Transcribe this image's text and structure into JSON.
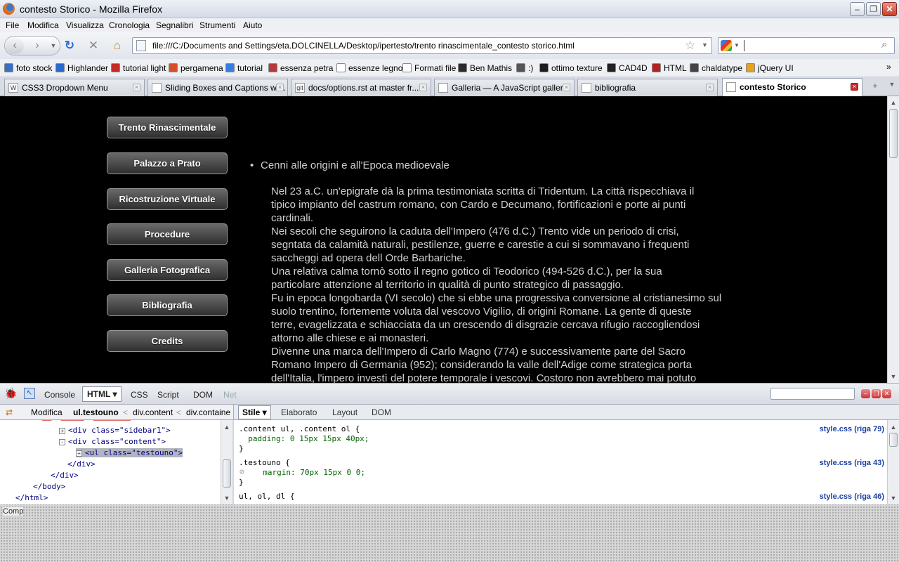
{
  "window": {
    "title": "contesto Storico - Mozilla Firefox"
  },
  "menu": [
    "File",
    "Modifica",
    "Visualizza",
    "Cronologia",
    "Segnalibri",
    "Strumenti",
    "Aiuto"
  ],
  "nav": {
    "url": "file:///C:/Documents and Settings/eta.DOLCINELLA/Desktop/ipertesto/trento rinascimentale_contesto storico.html",
    "search_value": ""
  },
  "bookmarks": [
    {
      "label": "foto stock",
      "icon": "folder-icon",
      "color": "#3b6fc2"
    },
    {
      "label": "Highlander",
      "icon": "highlander-icon",
      "color": "#2a6acb"
    },
    {
      "label": "tutorial light",
      "icon": "tutorial-icon",
      "color": "#c42a2a"
    },
    {
      "label": "pergamena",
      "icon": "vlc-icon",
      "color": "#d5502a"
    },
    {
      "label": "tutorial",
      "icon": "google-icon",
      "color": "#3a7de0"
    },
    {
      "label": "essenza petra",
      "icon": "essenza-icon",
      "color": "#b33a3a"
    },
    {
      "label": "essenze legno",
      "icon": "page-icon",
      "color": "#ffffff"
    },
    {
      "label": "Formati file",
      "icon": "page-icon",
      "color": "#ffffff"
    },
    {
      "label": "Ben Mathis",
      "icon": "benmathis-icon",
      "color": "#2b2b2b"
    },
    {
      "label": ":)",
      "icon": "p-icon",
      "color": "#555555"
    },
    {
      "label": "ottimo texture",
      "icon": "fst-icon",
      "color": "#1d1d1d"
    },
    {
      "label": "CAD4D",
      "icon": "cad4d-icon",
      "color": "#222222"
    },
    {
      "label": "HTML",
      "icon": "html-icon",
      "color": "#b22222"
    },
    {
      "label": "chaldatype",
      "icon": "chaldatype-icon",
      "color": "#444444"
    },
    {
      "label": "jQuery UI",
      "icon": "jquery-icon",
      "color": "#e8a31c"
    }
  ],
  "tabs": [
    {
      "label": "CSS3 Dropdown Menu",
      "icon": "W"
    },
    {
      "label": "Sliding Boxes and Captions wi...",
      "icon": ""
    },
    {
      "label": "docs/options.rst at master fr...",
      "icon": "git"
    },
    {
      "label": "Galleria — A JavaScript galler...",
      "icon": ""
    },
    {
      "label": "bibliografia",
      "icon": ""
    },
    {
      "label": "contesto Storico",
      "icon": ""
    }
  ],
  "sidebar_buttons": [
    "Trento Rinascimentale",
    "Palazzo a Prato",
    "Ricostruzione Virtuale",
    "Procedure",
    "Galleria Fotografica",
    "Bibliografia",
    "Credits"
  ],
  "content": {
    "heading": "Cenni alle origini e all'Epoca medioevale",
    "lines": [
      "Nel 23 a.C. un'epigrafe dà la prima testimoniata scritta di Tridentum. La città rispecchiava il",
      "tipico impianto del castrum romano, con Cardo e Decumano, fortificazioni e porte ai punti",
      "cardinali.",
      "Nei secoli che seguirono la caduta dell'Impero (476 d.C.) Trento vide un periodo di crisi,",
      "segntata da calamità naturali, pestilenze, guerre e carestie a cui si sommavano i frequenti",
      "saccheggi ad opera dell Orde Barbariche.",
      "Una relativa calma tornò sotto il regno gotico di Teodorico (494-526 d.C.), per la sua",
      "particolare attenzione al territorio in qualità di punto strategico di passaggio.",
      "Fu in epoca longobarda (VI secolo) che si ebbe una progressiva conversione al cristianesimo sul",
      "suolo trentino, fortemente voluta dal vescovo Vigilio, di origini Romane. La gente di queste",
      "terre, evagelizzata e schiacciata da un crescendo di disgrazie cercava rifugio raccogliendosi",
      "attorno alle chiese e ai monasteri.",
      "Divenne una marca dell'Impero di Carlo Magno (774) e successivamente parte del Sacro",
      "Romano Impero di Germania (952); considerando la valle dell'Adige come strategica porta",
      "dell'Italia, l'impero investì del potere temporale i vescovi. Costoro non avrebbero mai potuto"
    ]
  },
  "firebug": {
    "tabs": [
      "Console",
      "HTML",
      "CSS",
      "Script",
      "DOM",
      "Net"
    ],
    "active_tab": "HTML",
    "crumbs": [
      "Modifica",
      "ul.testouno",
      "<",
      "div.content",
      "<",
      "div.containe"
    ],
    "side_tabs": [
      "Stile",
      "Elaborato",
      "Layout",
      "DOM"
    ],
    "html_lines": [
      {
        "indent": "      ",
        "plus": false,
        "text": "<div class=\"sidebar1\">",
        "tag": "div",
        "attr": "class",
        "val": "sidebar1",
        "box": "+"
      },
      {
        "indent": "      ",
        "plus": false,
        "text": "<div class=\"content\">",
        "tag": "div",
        "attr": "class",
        "val": "content",
        "box": "-"
      },
      {
        "indent": "        ",
        "plus": true,
        "text": "<ul class=\"testouno\">",
        "tag": "ul",
        "attr": "class",
        "val": "testouno",
        "box": "+"
      },
      {
        "indent": "      ",
        "text": "</div>"
      },
      {
        "indent": "    ",
        "text": "</div>"
      },
      {
        "indent": "  ",
        "text": "</body>"
      },
      {
        "indent": "",
        "text": "</html>"
      }
    ],
    "css_rules": [
      {
        "selector": ".content ul, .content ol {",
        "prop": "  padding: 0 15px 15px 40px;",
        "close": "}",
        "source": "style.css (riga 79)"
      },
      {
        "selector": ".testouno {",
        "prop": "  margin: 70px 15px 0 0;",
        "close": "}",
        "source": "style.css (riga 43)"
      },
      {
        "selector": "ul, ol, dl {",
        "source": "style.css (riga 46)"
      }
    ],
    "status": "Comp"
  }
}
